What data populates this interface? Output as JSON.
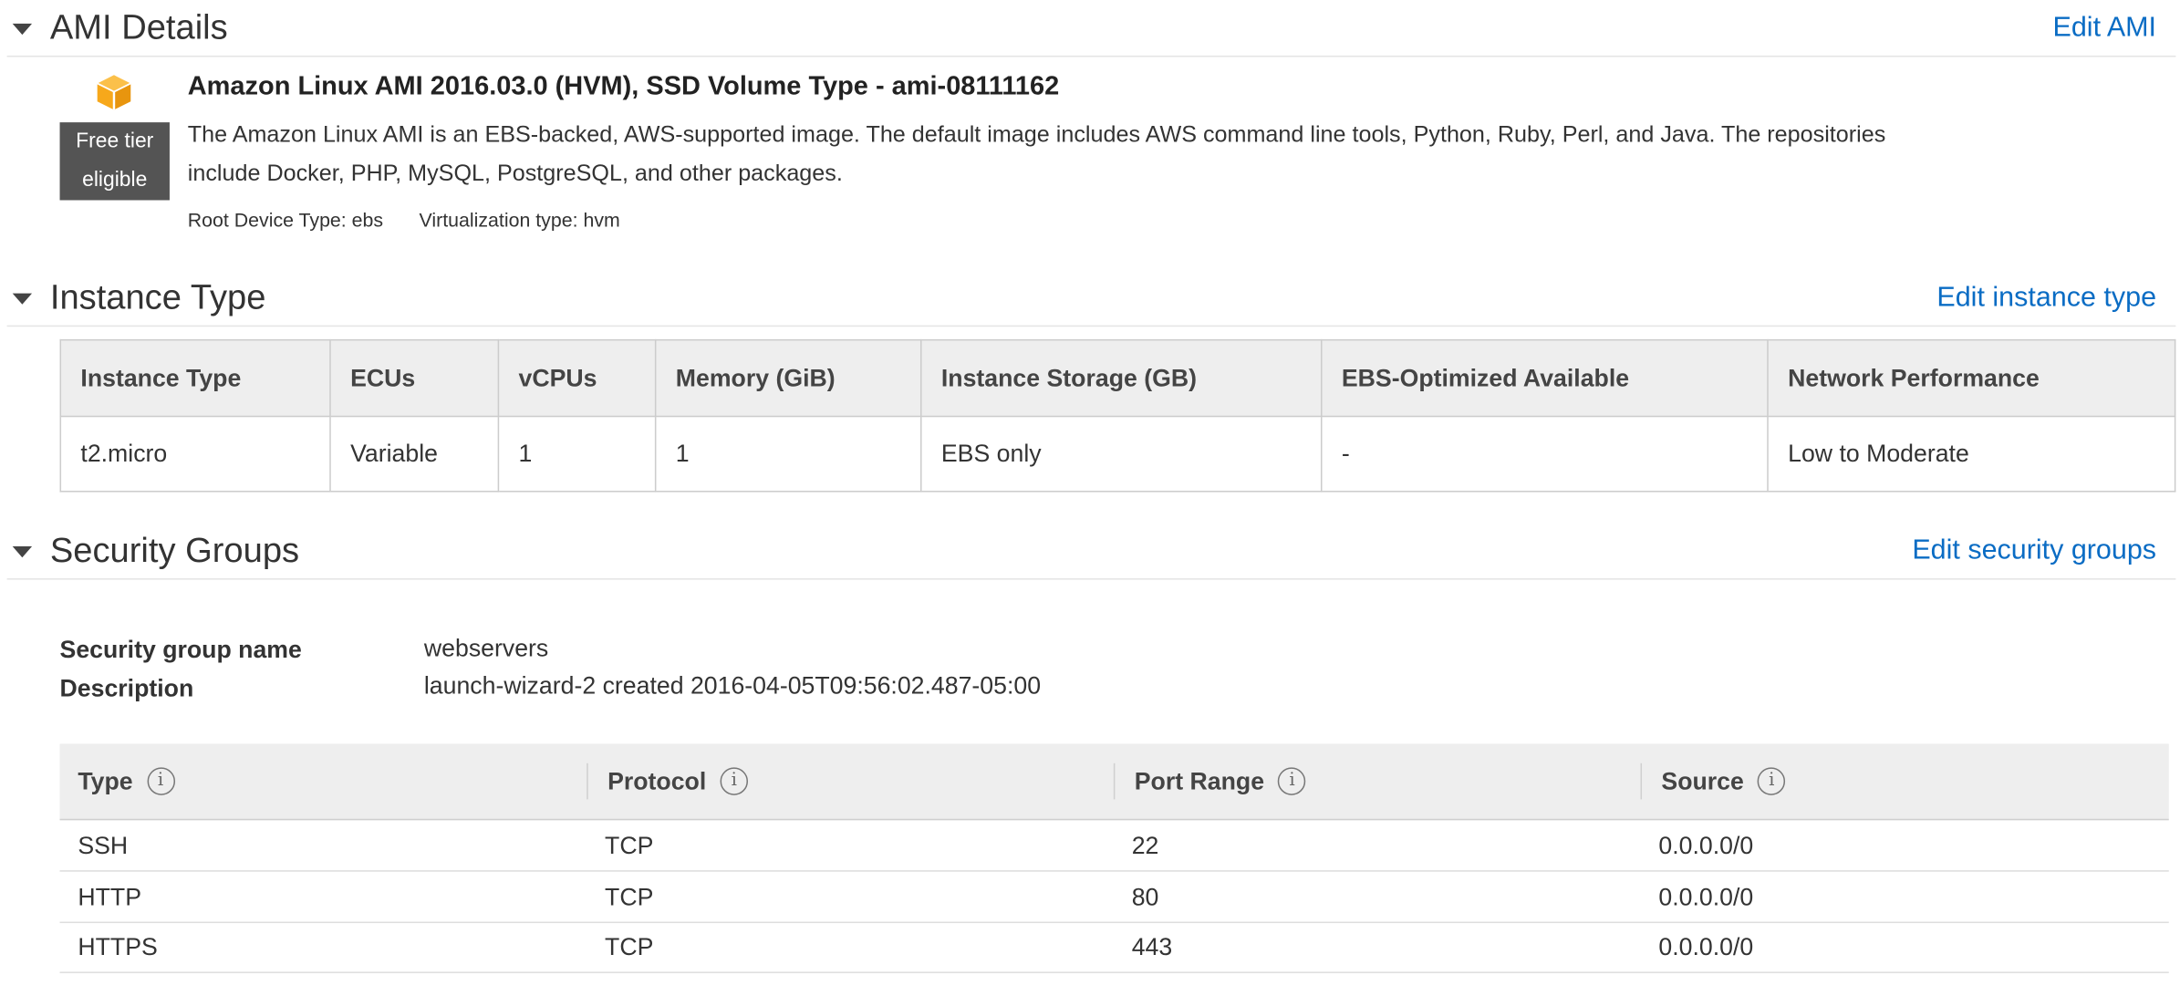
{
  "ami_section": {
    "title": "AMI Details",
    "edit_label": "Edit AMI",
    "ami_name": "Amazon Linux AMI 2016.03.0 (HVM), SSD Volume Type - ami-08111162",
    "description": "The Amazon Linux AMI is an EBS-backed, AWS-supported image. The default image includes AWS command line tools, Python, Ruby, Perl, and Java. The repositories include Docker, PHP, MySQL, PostgreSQL, and other packages.",
    "badge_line1": "Free tier",
    "badge_line2": "eligible",
    "root_device": "Root Device Type: ebs",
    "virtualization": "Virtualization type: hvm",
    "icon": "cube-icon",
    "icon_color": "#f7a81b"
  },
  "instance_section": {
    "title": "Instance Type",
    "edit_label": "Edit instance type",
    "headers": [
      "Instance Type",
      "ECUs",
      "vCPUs",
      "Memory (GiB)",
      "Instance Storage (GB)",
      "EBS-Optimized Available",
      "Network Performance"
    ],
    "rows": [
      [
        "t2.micro",
        "Variable",
        "1",
        "1",
        "EBS only",
        "-",
        "Low to Moderate"
      ]
    ]
  },
  "security_section": {
    "title": "Security Groups",
    "edit_label": "Edit security groups",
    "group_name_label": "Security group name",
    "group_name": "webservers",
    "description_label": "Description",
    "description": "launch-wizard-2 created 2016-04-05T09:56:02.487-05:00",
    "headers": [
      "Type",
      "Protocol",
      "Port Range",
      "Source"
    ],
    "info_glyph": "i",
    "rules": [
      [
        "SSH",
        "TCP",
        "22",
        "0.0.0.0/0"
      ],
      [
        "HTTP",
        "TCP",
        "80",
        "0.0.0.0/0"
      ],
      [
        "HTTPS",
        "TCP",
        "443",
        "0.0.0.0/0"
      ]
    ]
  },
  "colors": {
    "link": "#0a6cc4",
    "badge_bg": "#545454",
    "header_bg": "#eeeeee"
  }
}
